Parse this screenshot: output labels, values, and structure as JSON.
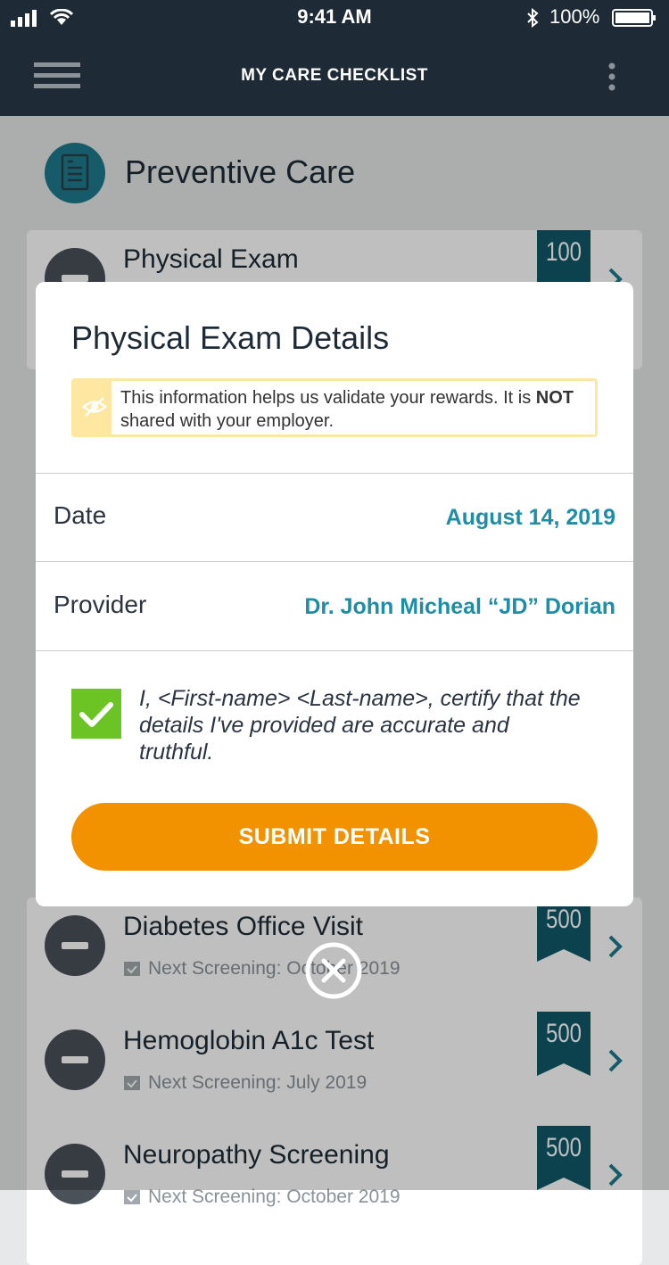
{
  "status_bar": {
    "time": "9:41 AM",
    "battery_pct": "100%"
  },
  "nav": {
    "title": "MY CARE CHECKLIST",
    "menu_icon": "hamburger-icon",
    "more_icon": "kebab-icon"
  },
  "section": {
    "title": "Preventive Care",
    "icon": "checklist-icon"
  },
  "cards": [
    {
      "title": "Physical Exam",
      "subtitle": "",
      "points": "100"
    },
    {
      "title": "Diabetes Office Visit",
      "subtitle": "Next Screening: October 2019",
      "points": "500"
    },
    {
      "title": "Hemoglobin A1c Test",
      "subtitle": "Next Screening: July 2019",
      "points": "500"
    },
    {
      "title": "Neuropathy Screening",
      "subtitle": "Next Screening: October 2019",
      "points": "500"
    }
  ],
  "modal": {
    "title": "Physical Exam Details",
    "notice_part1": "This information helps us validate your rewards. It is ",
    "notice_bold": "NOT",
    "notice_part2": " shared with your employer.",
    "date_label": "Date",
    "date_value": "August 14, 2019",
    "provider_label": "Provider",
    "provider_value": "Dr. John Micheal “JD” Dorian",
    "certify_text": "I, <First-name> <Last-name>, certify that the details I've provided are accurate and truthful.",
    "certify_checked": true,
    "submit_label": "SUBMIT DETAILS"
  },
  "colors": {
    "header": "#1e2b36",
    "accent_teal": "#1d8ea6",
    "submit": "#f39200",
    "check": "#6cc324",
    "notice": "#fde7a1"
  }
}
